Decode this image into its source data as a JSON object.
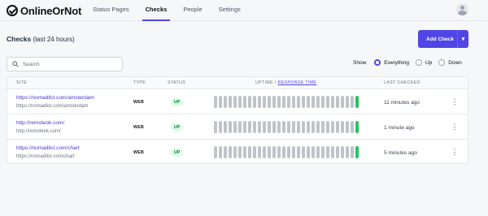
{
  "app": {
    "name": "OnlineOrNot"
  },
  "nav": [
    {
      "label": "Status Pages",
      "active": false
    },
    {
      "label": "Checks",
      "active": true
    },
    {
      "label": "People",
      "active": false
    },
    {
      "label": "Settings",
      "active": false
    }
  ],
  "header": {
    "title": "Checks",
    "subtitle": "(last 24 hours)",
    "add_button": "Add Check"
  },
  "search": {
    "placeholder": "Search",
    "value": ""
  },
  "filter": {
    "label": "Show",
    "options": [
      {
        "label": "Everything",
        "selected": true
      },
      {
        "label": "Up",
        "selected": false
      },
      {
        "label": "Down",
        "selected": false
      }
    ]
  },
  "table": {
    "columns": {
      "site": "SITE",
      "type": "TYPE",
      "status": "STATUS",
      "uptime": "UPTIME",
      "sep": "/",
      "response_time": "RESPONSE TIME",
      "last_checked": "LAST CHECKED"
    },
    "rows": [
      {
        "url": "https://nomadlist.com/amsterdam",
        "sub": "https://nomadlist.com/amsterdam",
        "type": "WEB",
        "status": "UP",
        "last_checked": "11 minutes ago"
      },
      {
        "url": "http://remoteok.com/",
        "sub": "http://remoteok.com/",
        "type": "WEB",
        "status": "UP",
        "last_checked": "1 minute ago"
      },
      {
        "url": "https://nomadlist.com/chart",
        "sub": "https://nomadlist.com/chart",
        "type": "WEB",
        "status": "UP",
        "last_checked": "5 minutes ago"
      }
    ]
  },
  "colors": {
    "accent": "#4f46e5",
    "up": "#22c55e",
    "bar_gray": "#c0c3c8"
  }
}
